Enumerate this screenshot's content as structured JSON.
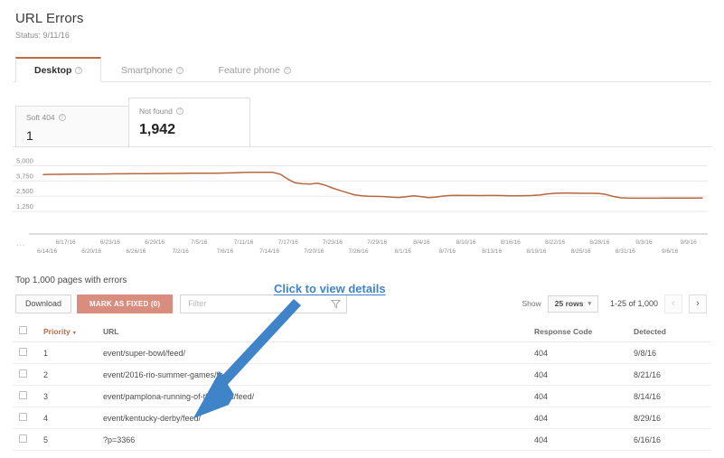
{
  "header": {
    "title": "URL Errors",
    "status": "Status: 9/11/16"
  },
  "tabs": [
    {
      "label": "Desktop",
      "help_icon": "question-mark-icon",
      "active": true
    },
    {
      "label": "Smartphone",
      "help_icon": "question-mark-icon",
      "active": false
    },
    {
      "label": "Feature phone",
      "help_icon": "question-mark-icon",
      "active": false
    }
  ],
  "cards": [
    {
      "label": "Soft 404",
      "value": "1",
      "help_icon": "question-mark-icon",
      "selected": false
    },
    {
      "label": "Not found",
      "value": "1,942",
      "help_icon": "question-mark-icon",
      "selected": true
    }
  ],
  "chart_data": {
    "type": "line",
    "title": "",
    "xlabel": "",
    "ylabel": "",
    "ylim": [
      0,
      5625
    ],
    "y_ticks": [
      "1,250",
      "2,500",
      "3,750",
      "5,000"
    ],
    "y_tick_values": [
      1250,
      2500,
      3750,
      5000
    ],
    "grid": true,
    "legend": null,
    "line_color": "#b5673f",
    "axis_leading_ellipsis": "...",
    "x_tick_labels_upper": [
      "6/17/16",
      "6/23/16",
      "6/29/16",
      "7/5/16",
      "7/11/16",
      "7/17/16",
      "7/23/16",
      "7/29/16",
      "8/4/16",
      "8/10/16",
      "8/16/16",
      "8/22/16",
      "8/28/16",
      "9/3/16",
      "9/9/16"
    ],
    "x_tick_labels_lower": [
      "6/14/16",
      "6/20/16",
      "6/26/16",
      "7/2/16",
      "7/8/16",
      "7/14/16",
      "7/20/16",
      "7/26/16",
      "8/1/16",
      "8/7/16",
      "8/13/16",
      "8/19/16",
      "8/25/16",
      "8/31/16",
      "9/6/16"
    ],
    "x": [
      "6/14/16",
      "6/15/16",
      "6/16/16",
      "6/17/16",
      "6/18/16",
      "6/19/16",
      "6/20/16",
      "6/21/16",
      "6/22/16",
      "6/23/16",
      "6/24/16",
      "6/25/16",
      "6/26/16",
      "6/27/16",
      "6/28/16",
      "6/29/16",
      "6/30/16",
      "7/1/16",
      "7/2/16",
      "7/3/16",
      "7/4/16",
      "7/5/16",
      "7/6/16",
      "7/7/16",
      "7/8/16",
      "7/9/16",
      "7/10/16",
      "7/11/16",
      "7/12/16",
      "7/13/16",
      "7/14/16",
      "7/15/16",
      "7/16/16",
      "7/17/16",
      "7/18/16",
      "7/19/16",
      "7/20/16",
      "7/21/16",
      "7/22/16",
      "7/23/16",
      "7/24/16",
      "7/25/16",
      "7/26/16",
      "7/27/16",
      "7/28/16",
      "7/29/16",
      "7/30/16",
      "7/31/16",
      "8/1/16",
      "8/2/16",
      "8/3/16",
      "8/4/16",
      "8/5/16",
      "8/6/16",
      "8/7/16",
      "8/8/16",
      "8/9/16",
      "8/10/16",
      "8/11/16",
      "8/12/16",
      "8/13/16",
      "8/14/16",
      "8/15/16",
      "8/16/16",
      "8/17/16",
      "8/18/16",
      "8/19/16",
      "8/20/16",
      "8/21/16",
      "8/22/16",
      "8/23/16",
      "8/24/16",
      "8/25/16",
      "8/26/16",
      "8/27/16",
      "8/28/16",
      "8/29/16",
      "8/30/16",
      "8/31/16",
      "9/1/16",
      "9/2/16",
      "9/3/16",
      "9/4/16",
      "9/5/16",
      "9/6/16",
      "9/7/16",
      "9/8/16",
      "9/9/16",
      "9/10/16",
      "9/11/16"
    ],
    "values": [
      4280,
      4290,
      4295,
      4300,
      4305,
      4310,
      4315,
      4320,
      4325,
      4330,
      4335,
      4340,
      4345,
      4350,
      4355,
      4358,
      4362,
      4366,
      4370,
      4374,
      4378,
      4382,
      4386,
      4392,
      4400,
      4412,
      4428,
      4445,
      4455,
      4460,
      4460,
      4455,
      4300,
      3900,
      3600,
      3520,
      3500,
      3560,
      3420,
      3180,
      2980,
      2800,
      2620,
      2540,
      2500,
      2490,
      2470,
      2430,
      2400,
      2460,
      2530,
      2470,
      2380,
      2420,
      2520,
      2560,
      2570,
      2560,
      2560,
      2555,
      2560,
      2560,
      2555,
      2540,
      2540,
      2545,
      2560,
      2600,
      2680,
      2740,
      2750,
      2750,
      2745,
      2740,
      2740,
      2730,
      2640,
      2480,
      2370,
      2345,
      2340,
      2340,
      2340,
      2340,
      2345,
      2345,
      2350,
      2350,
      2355,
      2360
    ]
  },
  "table_section": {
    "caption": "Top 1,000 pages with errors",
    "download_label": "Download",
    "mark_fixed_label": "MARK AS FIXED (0)",
    "filter_placeholder": "Filter",
    "filter_value": "",
    "filter_icon": "funnel-icon",
    "show_label": "Show",
    "rows_value": "25 rows",
    "range_label": "1-25 of 1,000",
    "prev_label": "‹",
    "next_label": "›",
    "columns": [
      "Priority",
      "URL",
      "Response Code",
      "Detected"
    ],
    "sorted_column": "Priority",
    "sort_direction": "descending",
    "rows": [
      {
        "priority": "1",
        "url": "event/super-bowl/feed/",
        "response_code": "404",
        "detected": "9/8/16"
      },
      {
        "priority": "2",
        "url": "event/2016-rio-summer-games/feed/",
        "response_code": "404",
        "detected": "8/21/16"
      },
      {
        "priority": "3",
        "url": "event/pamplona-running-of-the-bulls/feed/",
        "response_code": "404",
        "detected": "8/14/16"
      },
      {
        "priority": "4",
        "url": "event/kentucky-derby/feed/",
        "response_code": "404",
        "detected": "8/29/16"
      },
      {
        "priority": "5",
        "url": "?p=3366",
        "response_code": "404",
        "detected": "6/16/16"
      }
    ]
  },
  "annotation": {
    "text": "Click to view details",
    "color": "#3f84c8"
  }
}
